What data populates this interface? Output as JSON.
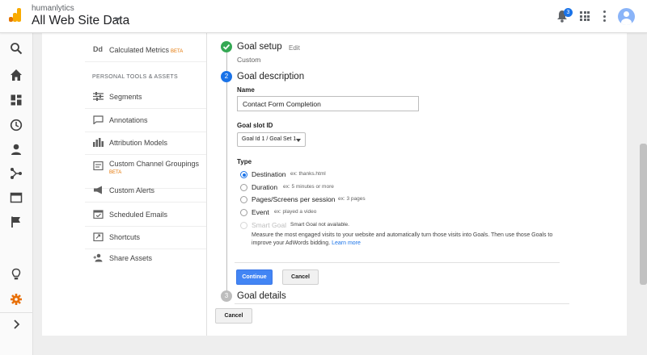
{
  "header": {
    "account_name": "humanlytics",
    "view_name": "All Web Site Data",
    "notification_count": "3",
    "brand_colors": {
      "orange": "#f9ab00",
      "dark_orange": "#e37400"
    }
  },
  "rail": {
    "icons": [
      "search-icon",
      "home-icon",
      "customization-icon",
      "clock-icon",
      "person-icon",
      "acquisition-icon",
      "behavior-icon",
      "flag-icon",
      "lightbulb-icon",
      "gear-icon",
      "chevron-right-icon"
    ],
    "active_color": "#e8710a"
  },
  "admin": {
    "calculated_metrics": {
      "icon_text": "Dd",
      "label": "Calculated Metrics",
      "badge": "BETA"
    },
    "section_heading": "PERSONAL TOOLS & ASSETS",
    "items": [
      {
        "label": "Segments",
        "icon": "segments-icon"
      },
      {
        "label": "Annotations",
        "icon": "comment-icon"
      },
      {
        "label": "Attribution Models",
        "icon": "bar-chart-icon"
      },
      {
        "label": "Custom Channel Groupings",
        "badge": "BETA",
        "icon": "channel-icon"
      },
      {
        "label": "Custom Alerts",
        "icon": "megaphone-icon"
      },
      {
        "label": "Scheduled Emails",
        "icon": "calendar-icon"
      },
      {
        "label": "Shortcuts",
        "icon": "shortcut-icon"
      },
      {
        "label": "Share Assets",
        "icon": "share-assets-icon"
      }
    ]
  },
  "goal": {
    "setup": {
      "title": "Goal setup",
      "edit_label": "Edit",
      "value": "Custom"
    },
    "description": {
      "step_number": "2",
      "title": "Goal description",
      "name_label": "Name",
      "name_value": "Contact Form Completion",
      "slot_label": "Goal slot ID",
      "slot_value": "Goal Id 1 / Goal Set 1",
      "type_label": "Type",
      "types": [
        {
          "label": "Destination",
          "hint": "ex: thanks.html",
          "selected": true
        },
        {
          "label": "Duration",
          "hint": "ex: 5 minutes or more",
          "selected": false
        },
        {
          "label": "Pages/Screens per session",
          "hint": "ex: 3 pages",
          "selected": false
        },
        {
          "label": "Event",
          "hint": "ex: played a video",
          "selected": false
        },
        {
          "label": "Smart Goal",
          "hint": "Smart Goal not available.",
          "selected": false,
          "disabled": true
        }
      ],
      "smart_goal_description": "Measure the most engaged visits to your website and automatically turn those visits into Goals. Then use those Goals to improve your AdWords bidding.",
      "learn_more": "Learn more",
      "continue_label": "Continue",
      "cancel_label": "Cancel"
    },
    "details": {
      "step_number": "3",
      "title": "Goal details"
    },
    "bottom_cancel_label": "Cancel"
  },
  "colors": {
    "primary": "#4285f4",
    "success": "#34a853",
    "step_active": "#1a73e8"
  }
}
